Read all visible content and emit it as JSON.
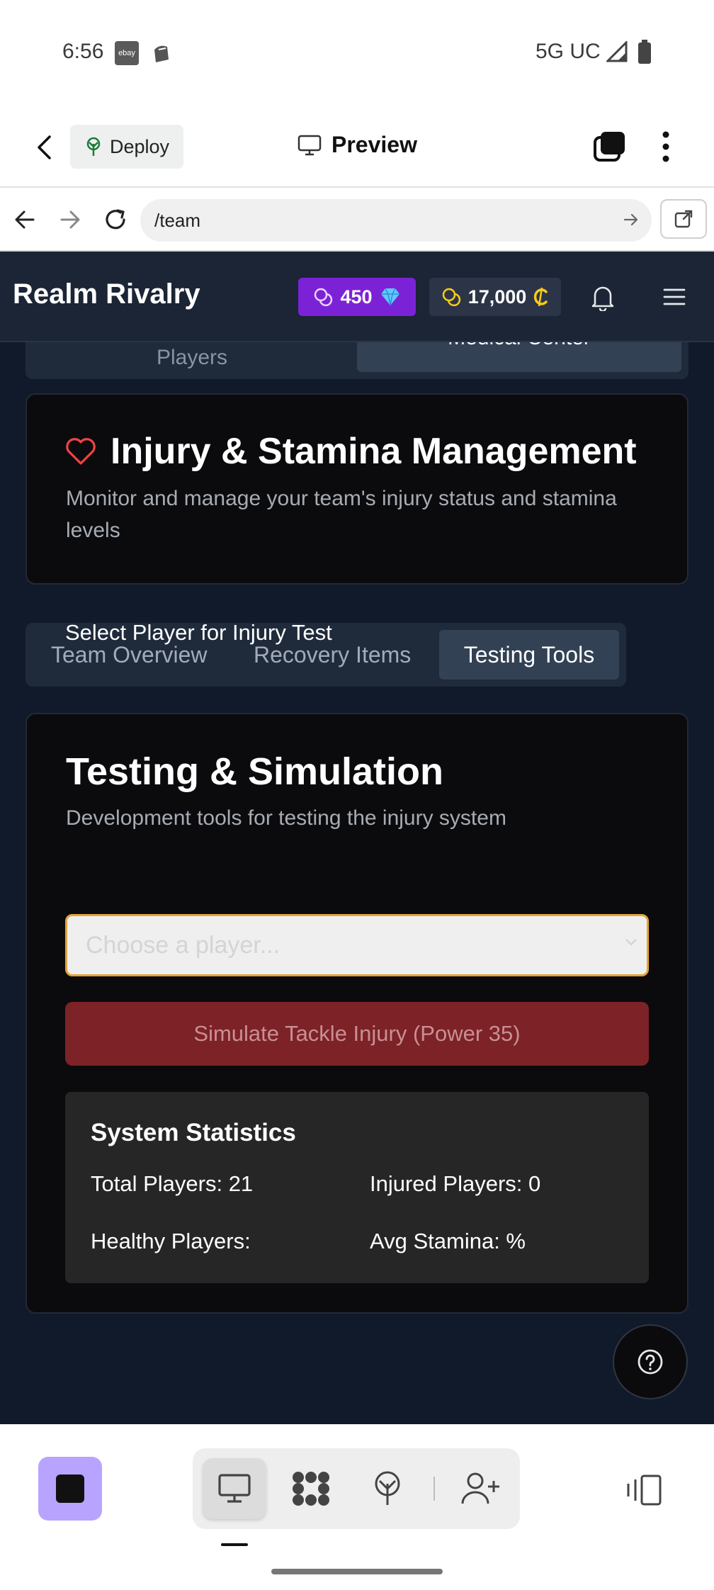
{
  "status_bar": {
    "time": "6:56",
    "ebay_icon_text": "ebay",
    "network": "5G UC"
  },
  "toolbar": {
    "deploy_label": "Deploy",
    "preview_label": "Preview"
  },
  "browser": {
    "url": "/team"
  },
  "app": {
    "brand": "Realm Rivalry",
    "gems": "450",
    "coins": "17,000",
    "top_tabs": [
      "Players",
      "Medical Center"
    ],
    "injury_card": {
      "title": "Injury & Stamina Management",
      "description": "Monitor and manage your team's injury status and stamina levels"
    },
    "sub_tabs": [
      "Team Overview",
      "Recovery Items",
      "Testing Tools"
    ],
    "testing_card": {
      "title": "Testing & Simulation",
      "description": "Development tools for testing the injury system",
      "select_label": "Select Player for Injury Test",
      "select_placeholder": "Choose a player...",
      "simulate_button": "Simulate Tackle Injury (Power 35)",
      "stats_title": "System Statistics",
      "stats": {
        "total": "Total Players: 21",
        "injured": "Injured Players: 0",
        "healthy": "Healthy Players:",
        "avg_stamina": "Avg Stamina: %"
      }
    }
  },
  "colors": {
    "gem_badge": "#7c22d6",
    "simulate_button": "#7d2227",
    "select_border": "#e3a43a",
    "app_background": "#111a2b",
    "heart": "#ef4444",
    "coin": "#facc15"
  }
}
